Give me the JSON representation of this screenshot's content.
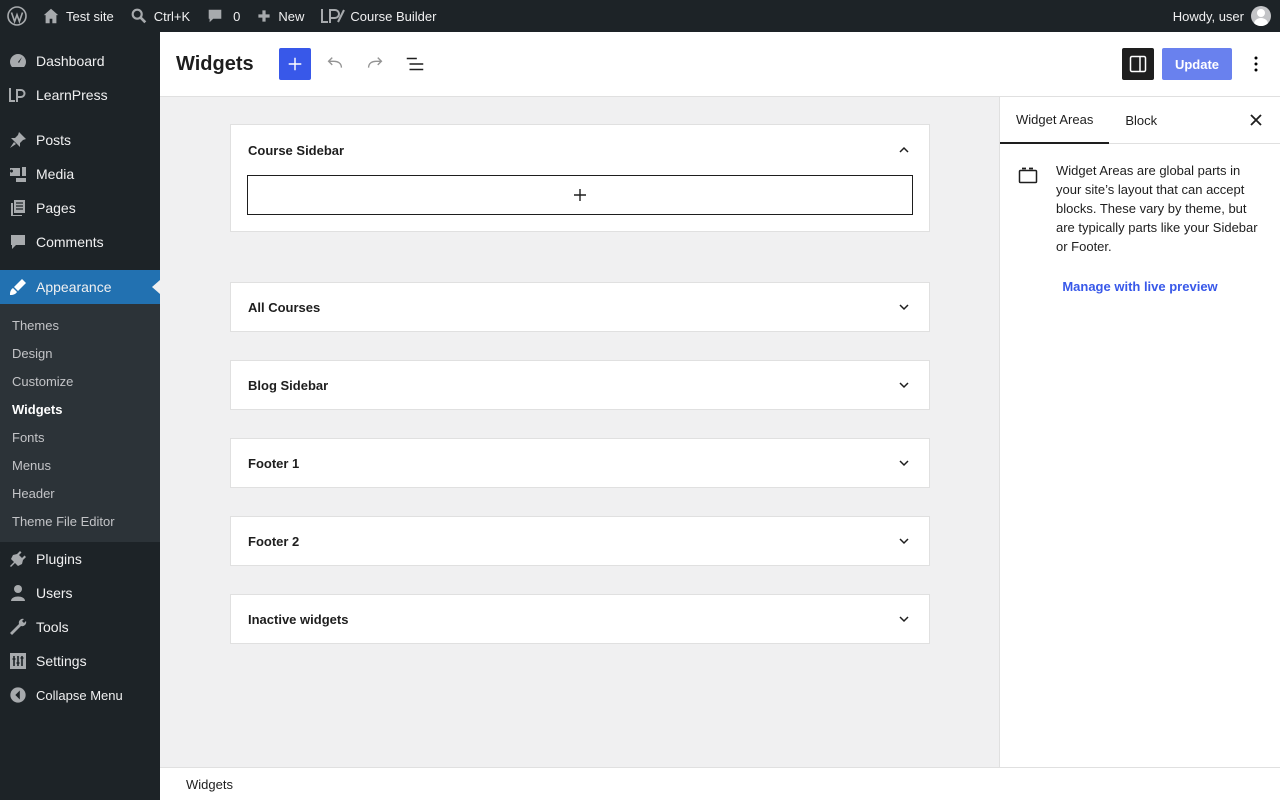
{
  "adminbar": {
    "site_name": "Test site",
    "search_shortcut": "Ctrl+K",
    "comments_count": "0",
    "new_label": "New",
    "course_builder": "Course Builder",
    "howdy": "Howdy, user"
  },
  "menu": {
    "dashboard": "Dashboard",
    "learnpress": "LearnPress",
    "posts": "Posts",
    "media": "Media",
    "pages": "Pages",
    "comments": "Comments",
    "appearance": "Appearance",
    "sub": [
      "Themes",
      "Design",
      "Customize",
      "Widgets",
      "Fonts",
      "Menus",
      "Header",
      "Theme File Editor"
    ],
    "plugins": "Plugins",
    "users": "Users",
    "tools": "Tools",
    "settings": "Settings",
    "collapse": "Collapse Menu"
  },
  "header": {
    "title": "Widgets",
    "update": "Update"
  },
  "widget_areas": [
    {
      "title": "Course Sidebar",
      "expanded": true
    },
    {
      "title": "All Courses",
      "expanded": false
    },
    {
      "title": "Blog Sidebar",
      "expanded": false
    },
    {
      "title": "Footer 1",
      "expanded": false
    },
    {
      "title": "Footer 2",
      "expanded": false
    },
    {
      "title": "Inactive widgets",
      "expanded": false
    }
  ],
  "sidebar": {
    "tab_widget_areas": "Widget Areas",
    "tab_block": "Block",
    "description": "Widget Areas are global parts in your site’s layout that can accept blocks. These vary by theme, but are typically parts like your Sidebar or Footer.",
    "live_preview": "Manage with live preview"
  },
  "footer": {
    "breadcrumb": "Widgets"
  },
  "colors": {
    "accent": "#3858e9",
    "admin_dark": "#1d2327",
    "menu_current": "#2271b1"
  }
}
